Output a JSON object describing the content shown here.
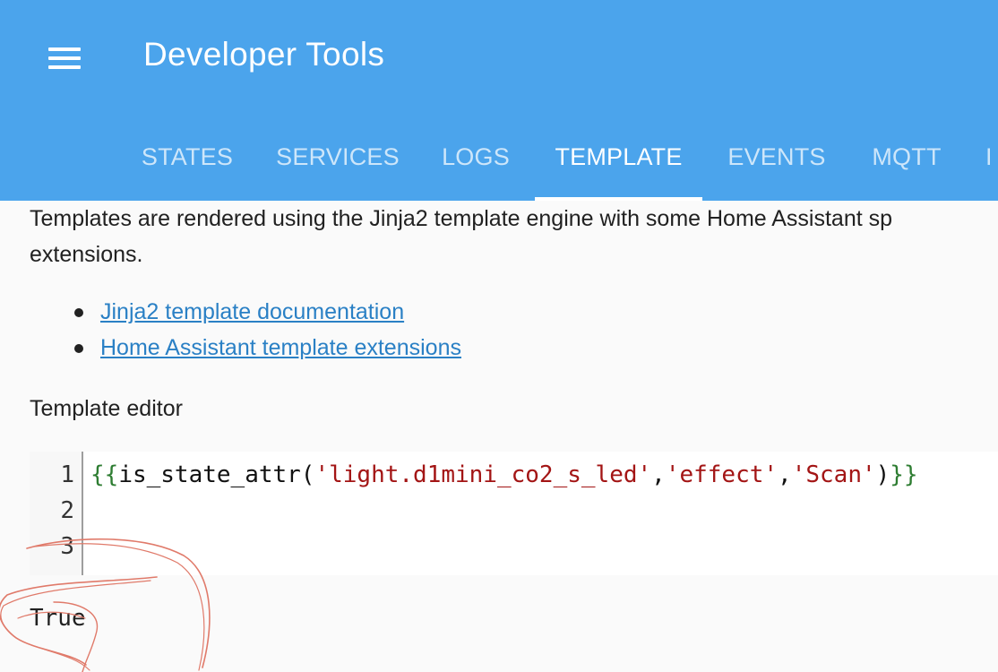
{
  "header": {
    "title": "Developer Tools",
    "menu_icon": "hamburger-menu-icon",
    "background_color": "#4ba4ec",
    "tabs": [
      {
        "label": "STATES",
        "active": false
      },
      {
        "label": "SERVICES",
        "active": false
      },
      {
        "label": "LOGS",
        "active": false
      },
      {
        "label": "TEMPLATE",
        "active": true
      },
      {
        "label": "EVENTS",
        "active": false
      },
      {
        "label": "MQTT",
        "active": false
      },
      {
        "label": "I",
        "active": false
      }
    ]
  },
  "main": {
    "intro_line1": "Templates are rendered using the Jinja2 template engine with some Home Assistant sp",
    "intro_line2": "extensions.",
    "links": [
      {
        "label": "Jinja2 template documentation"
      },
      {
        "label": "Home Assistant template extensions"
      }
    ],
    "editor_label": "Template editor",
    "editor": {
      "line_numbers": [
        "1",
        "2",
        "3"
      ],
      "code": {
        "open_braces": "{{",
        "func": "is_state_attr(",
        "arg1": "'light.d1mini_co2_s_led'",
        "comma1": ",",
        "arg2": "'effect'",
        "comma2": ",",
        "arg3": "'Scan'",
        "close_paren": ")",
        "close_braces": "}}"
      }
    },
    "result": "True"
  },
  "colors": {
    "link": "#2a80c5",
    "string": "#a31515",
    "braces": "#2e7d32",
    "scribble": "#e07a6a"
  }
}
